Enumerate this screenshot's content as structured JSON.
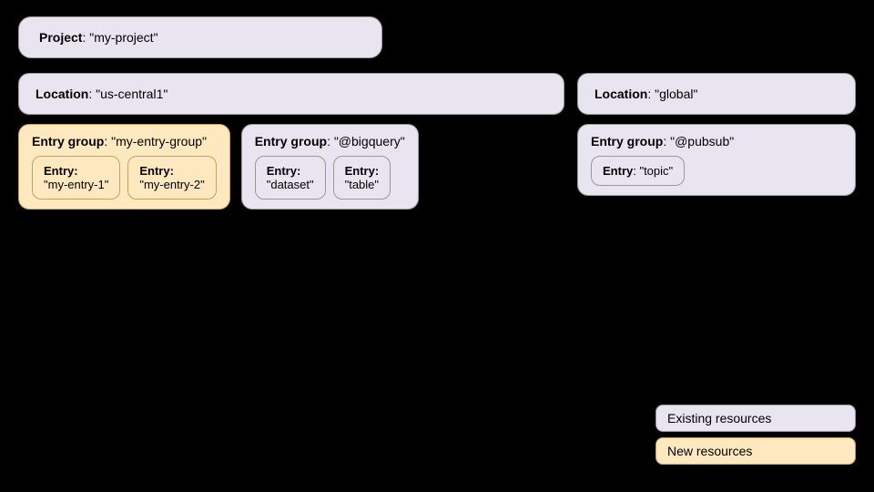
{
  "project": {
    "label": "Project",
    "value": "\"my-project\""
  },
  "location_left": {
    "label": "Location",
    "value": "\"us-central1\""
  },
  "location_right": {
    "label": "Location",
    "value": "\"global\""
  },
  "entry_groups": [
    {
      "id": "my-entry-group",
      "label": "Entry group",
      "value": "\"my-entry-group\"",
      "style": "orange",
      "entries": [
        {
          "label": "Entry",
          "value": "\"my-entry-1\"",
          "style": "orange"
        },
        {
          "label": "Entry",
          "value": "\"my-entry-2\"",
          "style": "orange"
        }
      ]
    },
    {
      "id": "bigquery",
      "label": "Entry group",
      "value": "\"@bigquery\"",
      "style": "white",
      "entries": [
        {
          "label": "Entry",
          "value": "\"dataset\"",
          "style": "white"
        },
        {
          "label": "Entry",
          "value": "\"table\"",
          "style": "white"
        }
      ]
    },
    {
      "id": "pubsub",
      "label": "Entry group",
      "value": "\"@pubsub\"",
      "style": "white",
      "entries": [
        {
          "label": "Entry",
          "value": "\"topic\"",
          "style": "white"
        }
      ]
    }
  ],
  "legend": {
    "existing_label": "Existing resources",
    "new_label": "New resources"
  }
}
